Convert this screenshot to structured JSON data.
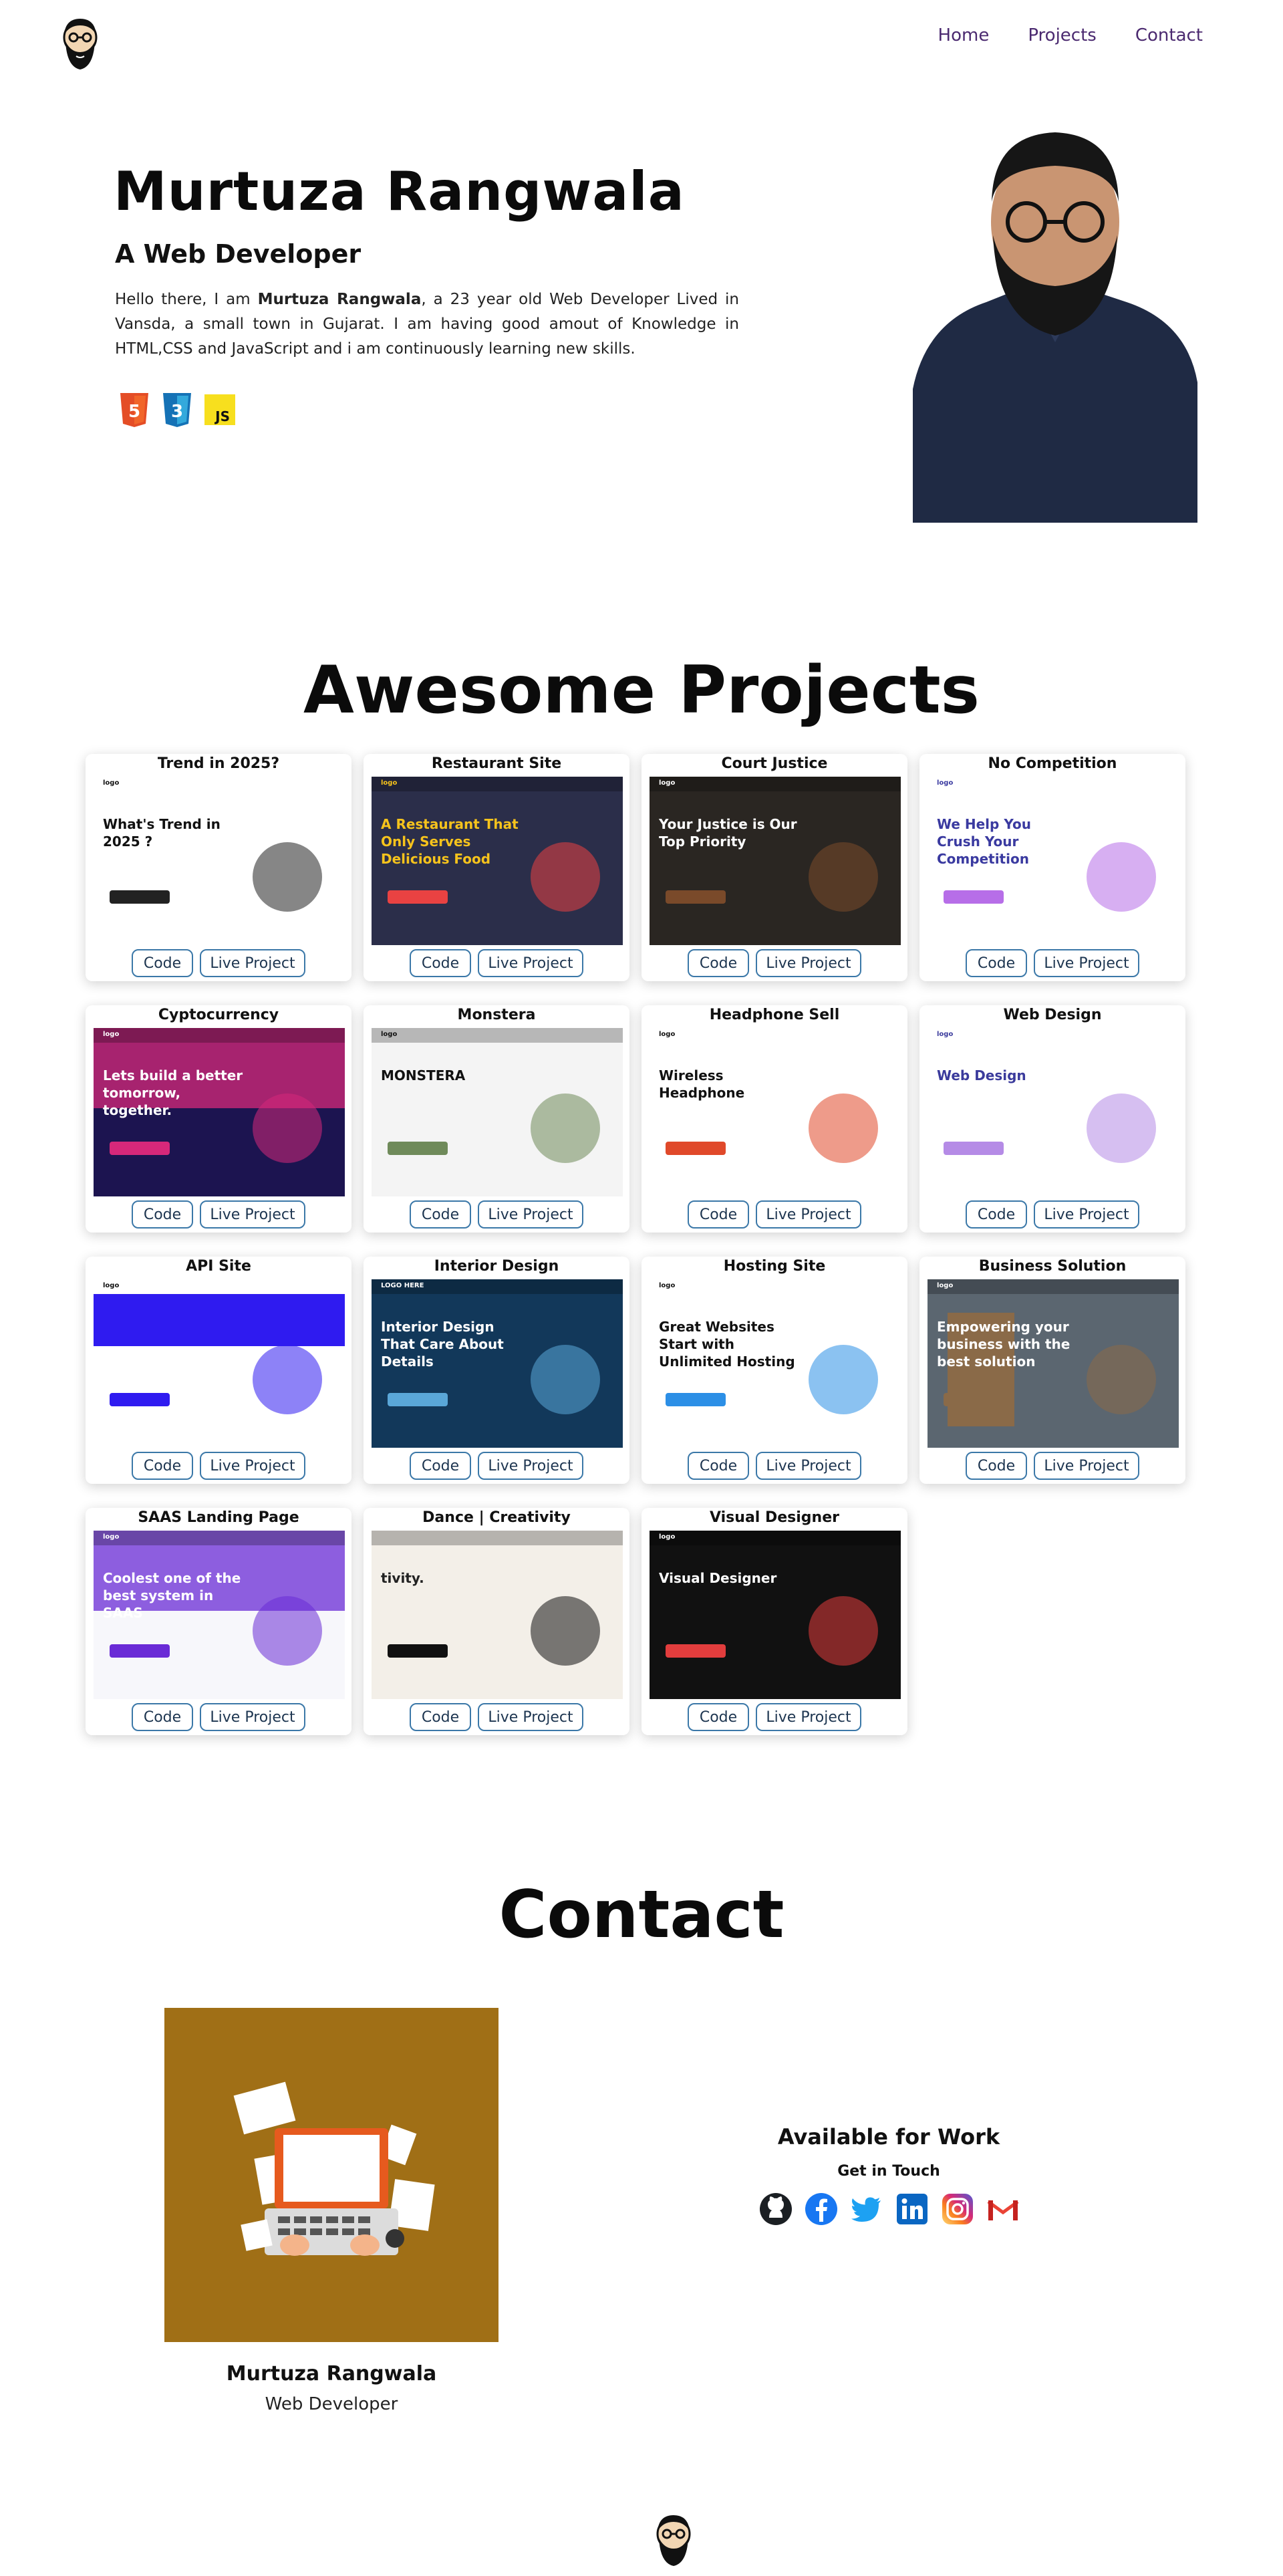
{
  "nav": {
    "home": "Home",
    "projects": "Projects",
    "contact": "Contact"
  },
  "hero": {
    "name": "Murtuza Rangwala",
    "subtitle": "A Web Developer",
    "bio_before": "Hello there, I am ",
    "bio_name": "Murtuza Rangwala",
    "bio_after": ", a 23 year old Web Developer Lived in Vansda, a small town in Gujarat. I am having good amout of Knowledge in HTML,CSS and JavaScript and i am continuously learning new skills.",
    "tech": [
      "html5-icon",
      "css3-icon",
      "javascript-icon"
    ],
    "js_label": "JS"
  },
  "projects": {
    "title": "Awesome Projects",
    "code_label": "Code",
    "live_label": "Live Project",
    "items": [
      {
        "title": "Trend in 2025?",
        "thumb_headline": "What's Trend in 2025 ?",
        "logo": "logo"
      },
      {
        "title": "Restaurant Site",
        "thumb_headline": "A Restaurant That Only Serves Delicious Food",
        "logo": "logo"
      },
      {
        "title": "Court Justice",
        "thumb_headline": "Your Justice is Our Top Priority",
        "logo": "logo"
      },
      {
        "title": "No Competition",
        "thumb_headline": "We Help You Crush Your Competition",
        "logo": "logo"
      },
      {
        "title": "Cyptocurrency",
        "thumb_headline": "Lets build a better tomorrow, together.",
        "logo": "logo"
      },
      {
        "title": "Monstera",
        "thumb_headline": "MONSTERA",
        "logo": "logo"
      },
      {
        "title": "Headphone Sell",
        "thumb_headline": "Wireless Headphone",
        "logo": "logo"
      },
      {
        "title": "Web Design",
        "thumb_headline": "Web Design",
        "logo": "logo"
      },
      {
        "title": "API Site",
        "thumb_headline": "",
        "logo": "logo"
      },
      {
        "title": "Interior Design",
        "thumb_headline": "Interior Design That Care About Details",
        "logo": "LOGO HERE"
      },
      {
        "title": "Hosting Site",
        "thumb_headline": "Great Websites Start with Unlimited Hosting",
        "logo": "logo"
      },
      {
        "title": "Business Solution",
        "thumb_headline": "Empowering your business with the best solution",
        "logo": "logo"
      },
      {
        "title": "SAAS Landing Page",
        "thumb_headline": "Coolest one of the best system in SAAS",
        "logo": "logo"
      },
      {
        "title": "Dance | Creativity",
        "thumb_headline": "tivity.",
        "logo": ""
      },
      {
        "title": "Visual Designer",
        "thumb_headline": "Visual Designer",
        "logo": "logo"
      }
    ]
  },
  "contact": {
    "title": "Contact",
    "name": "Murtuza Rangwala",
    "role": "Web Developer",
    "available": "Available for Work",
    "get_in_touch": "Get in Touch",
    "socials": [
      "github-icon",
      "facebook-icon",
      "twitter-icon",
      "linkedin-icon",
      "instagram-icon",
      "gmail-icon"
    ]
  },
  "colors": {
    "nav_link": "#4b2a70",
    "button_border": "#3b78a8",
    "illustration_bg": "#a06f16"
  }
}
